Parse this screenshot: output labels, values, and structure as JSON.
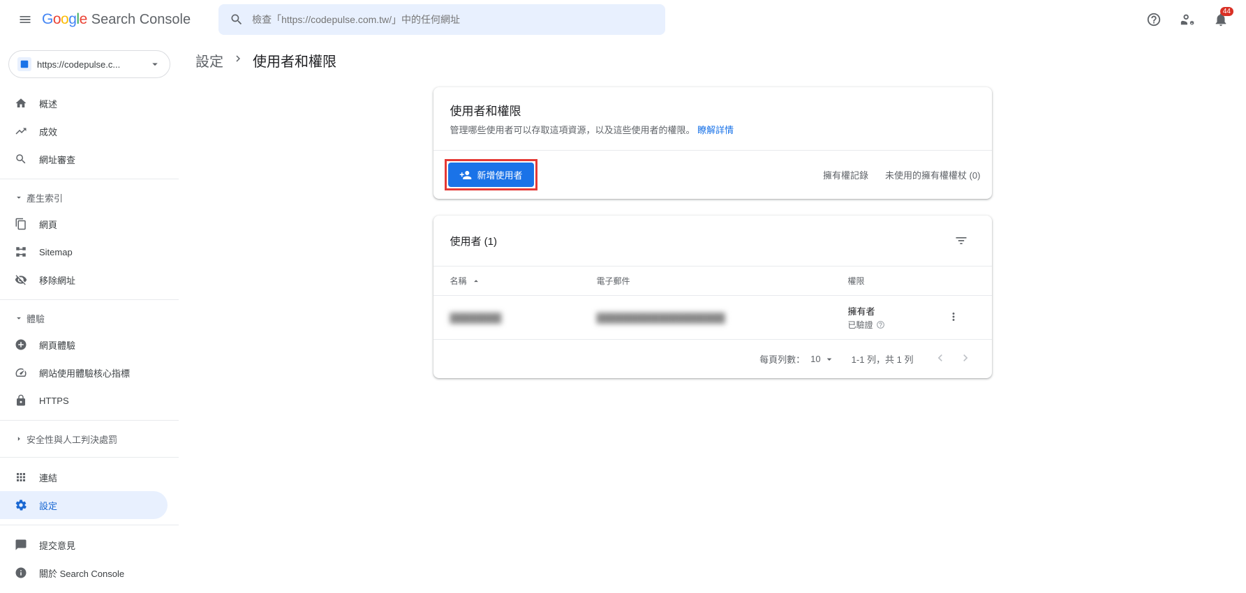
{
  "header": {
    "product_name": "Search Console",
    "search_placeholder": "檢查「https://codepulse.com.tw/」中的任何網址",
    "notification_count": "44"
  },
  "sidebar": {
    "property": "https://codepulse.c...",
    "items": {
      "overview": "概述",
      "performance": "成效",
      "url_inspection": "網址審查"
    },
    "section_indexing": "產生索引",
    "indexing_items": {
      "pages": "網頁",
      "sitemap": "Sitemap",
      "removals": "移除網址"
    },
    "section_experience": "體驗",
    "experience_items": {
      "page_experience": "網頁體驗",
      "core_vitals": "網站使用體驗核心指標",
      "https": "HTTPS"
    },
    "section_security": "安全性與人工判決處罰",
    "links": "連結",
    "settings": "設定",
    "feedback": "提交意見",
    "about": "關於 Search Console"
  },
  "breadcrumb": {
    "parent": "設定",
    "current": "使用者和權限"
  },
  "card1": {
    "title": "使用者和權限",
    "subtitle_pre": "管理哪些使用者可以存取這項資源，以及這些使用者的權限。",
    "subtitle_link": "瞭解詳情",
    "add_user_btn": "新增使用者",
    "link_history": "擁有權記錄",
    "link_unused": "未使用的擁有權權杖 (0)"
  },
  "table": {
    "title": "使用者 (1)",
    "col_name": "名稱",
    "col_email": "電子郵件",
    "col_perm": "權限",
    "row1": {
      "name": "████████",
      "email": "████████████████████",
      "perm_main": "擁有者",
      "perm_sub": "已驗證"
    },
    "footer": {
      "rows_label": "每頁列數：",
      "rows_value": "10",
      "range": "1-1 列，共 1 列"
    }
  }
}
